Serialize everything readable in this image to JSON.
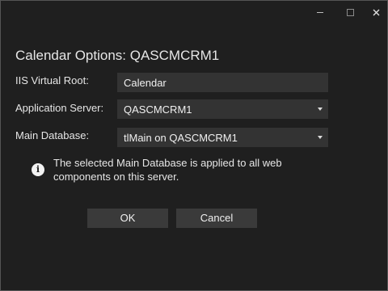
{
  "window": {
    "controls": {
      "minimize": "minimize-icon",
      "maximize": "maximize-icon",
      "close": "close-icon"
    }
  },
  "dialog": {
    "title": "Calendar Options: QASCMCRM1",
    "fields": {
      "iis_virtual_root": {
        "label": "IIS Virtual Root:",
        "value": "Calendar"
      },
      "application_server": {
        "label": "Application Server:",
        "value": "QASCMCRM1"
      },
      "main_database": {
        "label": "Main Database:",
        "value": "tlMain on QASCMCRM1"
      }
    },
    "info": {
      "icon": "info-icon",
      "text": "The selected Main Database is applied to all web components on this server."
    },
    "buttons": {
      "ok": "OK",
      "cancel": "Cancel"
    }
  }
}
